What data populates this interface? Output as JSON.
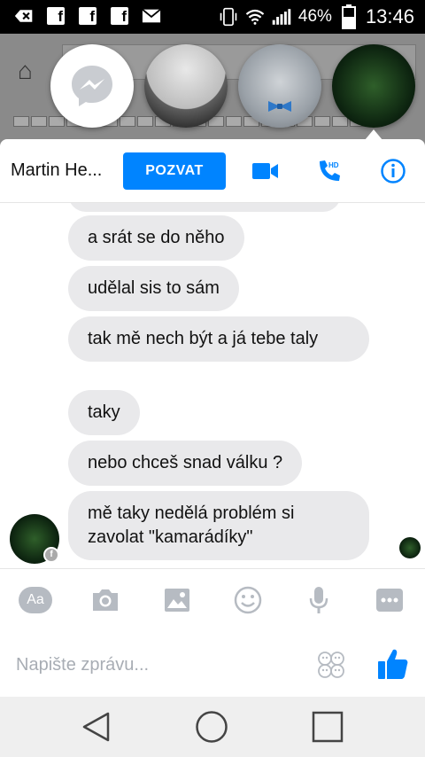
{
  "status_bar": {
    "battery": "46%",
    "time": "13:46",
    "icons": [
      "back-icon",
      "facebook-icon",
      "facebook-icon",
      "facebook-icon",
      "mail-icon",
      "vibrate-icon",
      "wifi-icon",
      "signal-icon",
      "battery-icon"
    ]
  },
  "chat_heads": [
    {
      "name": "messenger-icon"
    },
    {
      "name": "contact-avatar"
    },
    {
      "name": "contact-avatar"
    },
    {
      "name": "contact-avatar"
    }
  ],
  "header": {
    "contact_name": "Martin He...",
    "invite_label": "POZVAT",
    "icons": [
      "video-call-icon",
      "hd-call-icon",
      "info-icon"
    ],
    "accent": "#0084ff"
  },
  "messages": [
    {
      "text": "a srát se do něho"
    },
    {
      "text": "udělal sis to sám"
    },
    {
      "text": "tak mě nech být a já tebe taly"
    },
    {
      "text": "taky"
    },
    {
      "text": "nebo chceš snad válku ?"
    },
    {
      "text": "mě taky nedělá problém si zavolat \"kamarádíky\""
    }
  ],
  "composer": {
    "aa_label": "Aa",
    "placeholder": "Napište zprávu...",
    "icons": [
      "text-style-icon",
      "camera-icon",
      "gallery-icon",
      "emoji-icon",
      "microphone-icon",
      "more-icon",
      "stickers-icon",
      "like-icon"
    ]
  },
  "nav": {
    "icons": [
      "back-nav-icon",
      "home-nav-icon",
      "recents-nav-icon"
    ]
  },
  "colors": {
    "bubble": "#e9e9eb",
    "like": "#0084ff"
  }
}
